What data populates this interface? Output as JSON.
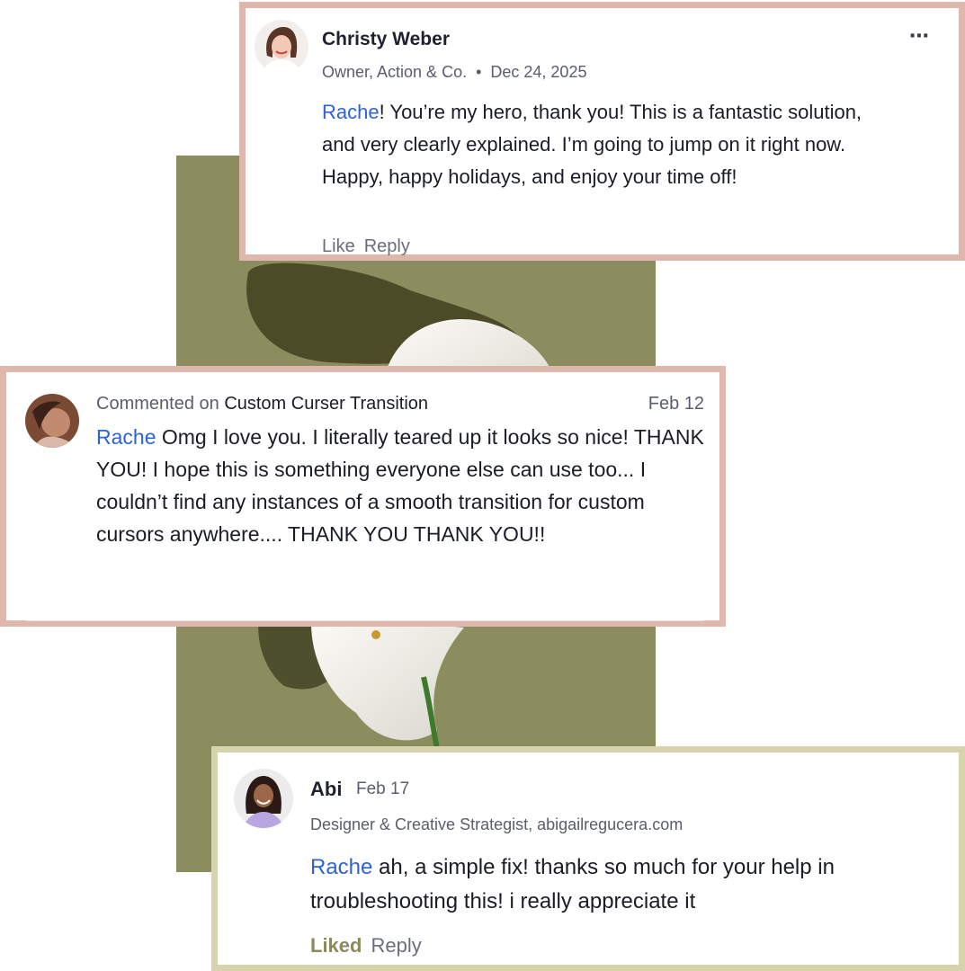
{
  "comments": [
    {
      "author": "Christy Weber",
      "role": "Owner, Action & Co.",
      "separator": "•",
      "date": "Dec 24, 2025",
      "mention": "Rache",
      "text": "! You’re my hero, thank you! This is a fantastic solution, and very clearly explained. I’m going to jump on it right now. Happy, happy holidays, and enjoy your time off!",
      "like_label": "Like",
      "reply_label": "Reply",
      "more_icon": "more-options-icon",
      "border_color": "#e0b7ad"
    },
    {
      "prefix": "Commented on",
      "post_title": "Custom Curser Transition",
      "date": "Feb 12",
      "mention": "Rache",
      "text": " Omg I love you. I literally teared up it looks so nice! THANK YOU! I hope this is something everyone else can use too... I couldn’t find any instances of a smooth transition for custom cursors anywhere.... THANK YOU THANK YOU!!",
      "border_color": "#e0b7ad"
    },
    {
      "author": "Abi",
      "date": "Feb 17",
      "role": "Designer & Creative Strategist, abigailregucera.com",
      "mention": "Rache",
      "text": " ah, a simple fix! thanks so much for your help in troubleshooting this! i really appreciate it",
      "like_label": "Liked",
      "reply_label": "Reply",
      "border_color": "#d6d3ad"
    }
  ],
  "colors": {
    "mention": "#2d63d6",
    "photo_background": "#8c8d5f",
    "liked": "#8a8a5e"
  }
}
